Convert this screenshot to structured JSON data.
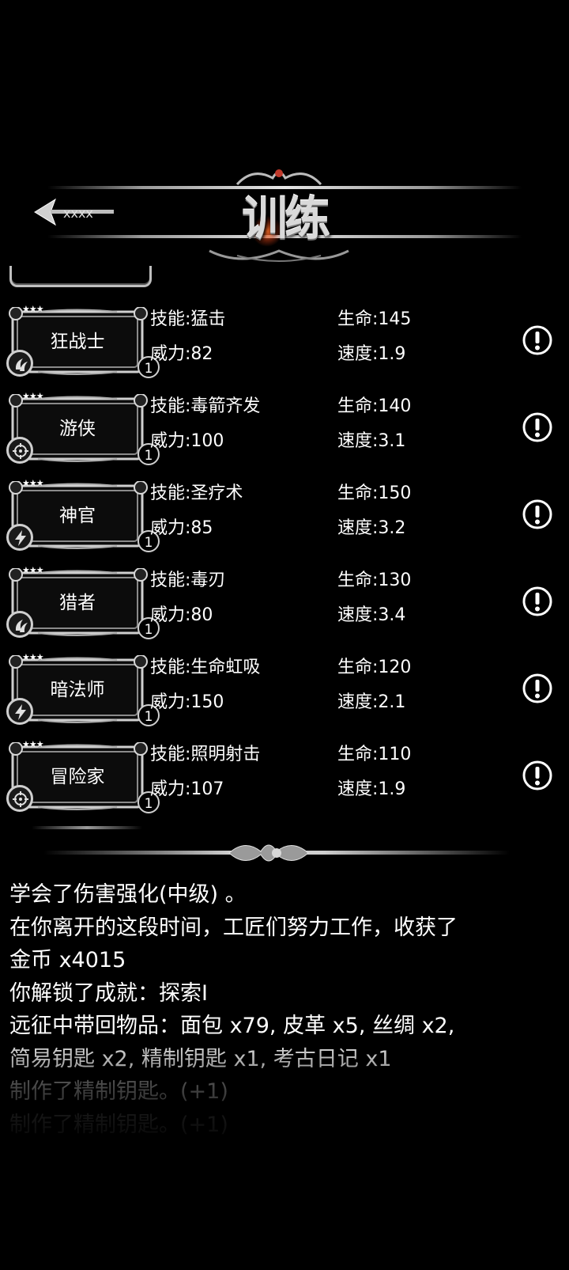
{
  "header": {
    "title": "训练",
    "back_icon": "ornate-back-arrow-icon"
  },
  "heroes": [
    {
      "name": "狂战士",
      "level": "1",
      "type_icon": "claw-icon",
      "skill": "技能:猛击",
      "power": "威力:82",
      "hp": "生命:145",
      "speed": "速度:1.9"
    },
    {
      "name": "游侠",
      "level": "1",
      "type_icon": "crosshair-icon",
      "skill": "技能:毒箭齐发",
      "power": "威力:100",
      "hp": "生命:140",
      "speed": "速度:3.1"
    },
    {
      "name": "神官",
      "level": "1",
      "type_icon": "lightning-icon",
      "skill": "技能:圣疗术",
      "power": "威力:85",
      "hp": "生命:150",
      "speed": "速度:3.2"
    },
    {
      "name": "猎者",
      "level": "1",
      "type_icon": "claw-icon",
      "skill": "技能:毒刃",
      "power": "威力:80",
      "hp": "生命:130",
      "speed": "速度:3.4"
    },
    {
      "name": "暗法师",
      "level": "1",
      "type_icon": "lightning-icon",
      "skill": "技能:生命虹吸",
      "power": "威力:150",
      "hp": "生命:120",
      "speed": "速度:2.1"
    },
    {
      "name": "冒险家",
      "level": "1",
      "type_icon": "crosshair-icon",
      "skill": "技能:照明射击",
      "power": "威力:107",
      "hp": "生命:110",
      "speed": "速度:1.9"
    }
  ],
  "info_icon": "exclamation-circle-icon",
  "log": [
    "学会了伤害强化(中级) 。",
    "在你离开的这段时间，工匠们努力工作，收获了",
    "金币 x4015",
    "你解锁了成就：探索I",
    "远征中带回物品：面包 x79, 皮革 x5, 丝绸 x2,",
    "简易钥匙 x2, 精制钥匙 x1, 考古日记 x1",
    "制作了精制钥匙。(+1)",
    "制作了精制钥匙。(+1)"
  ]
}
